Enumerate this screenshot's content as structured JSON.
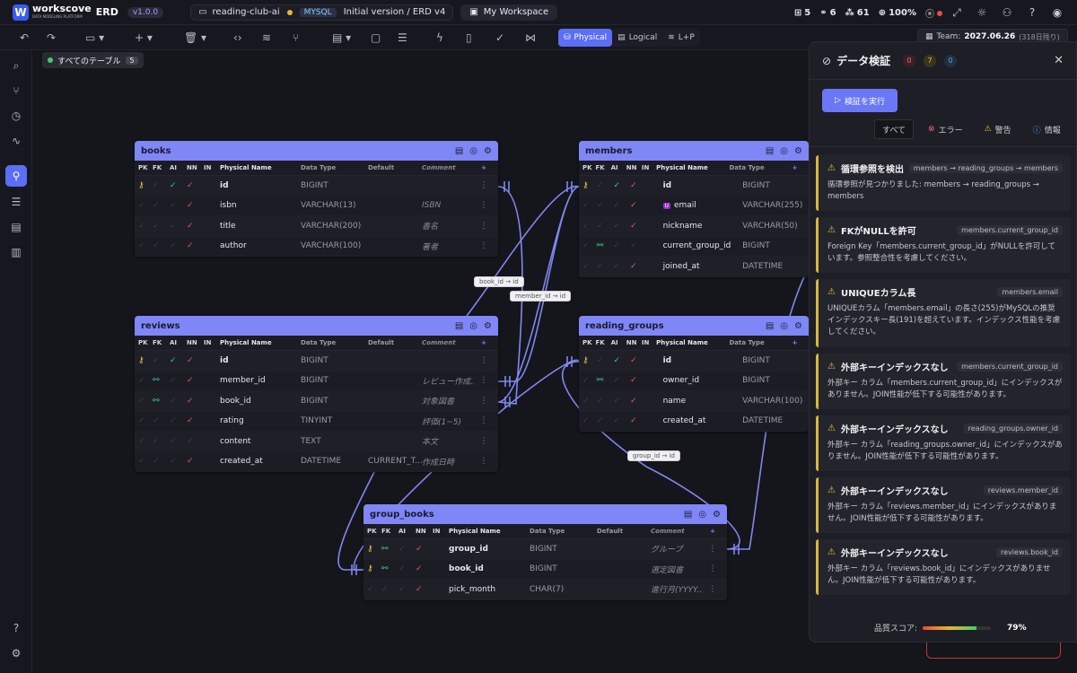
{
  "header": {
    "brand": "workscove",
    "brand_sub": "DATA MODELING PLATFORM",
    "app": "ERD",
    "version": "v1.0.0",
    "project": "reading-club-ai",
    "db": "MYSQL",
    "version_name": "Initial version / ERD v4",
    "workspace": "My Workspace",
    "stats": {
      "tables": "5",
      "relations": "6",
      "nodes": "61",
      "zoom": "100%"
    }
  },
  "toolbar": {
    "view_physical": "Physical",
    "view_logical": "Logical",
    "view_lp": "L+P",
    "team_label": "Team:",
    "team_date": "2027.06.26",
    "team_days": "(318日残り)"
  },
  "canvas": {
    "tab_label": "すべてのテーブル",
    "tab_count": "5"
  },
  "columns": [
    "PK",
    "FK",
    "AI",
    "NN",
    "IN",
    "Physical Name",
    "Data Type",
    "Default",
    "Comment"
  ],
  "tables": {
    "books": {
      "name": "books",
      "rows": [
        [
          "id",
          "BIGINT",
          "",
          ""
        ],
        [
          "isbn",
          "VARCHAR(13)",
          "",
          "ISBN"
        ],
        [
          "title",
          "VARCHAR(200)",
          "",
          "書名"
        ],
        [
          "author",
          "VARCHAR(100)",
          "",
          "著者"
        ]
      ]
    },
    "members": {
      "name": "members",
      "rows": [
        [
          "id",
          "BIGINT",
          "",
          ""
        ],
        [
          "email",
          "VARCHAR(255)",
          "",
          ""
        ],
        [
          "nickname",
          "VARCHAR(50)",
          "",
          ""
        ],
        [
          "current_group_id",
          "BIGINT",
          "",
          ""
        ],
        [
          "joined_at",
          "DATETIME",
          "",
          ""
        ]
      ]
    },
    "reviews": {
      "name": "reviews",
      "rows": [
        [
          "id",
          "BIGINT",
          "",
          ""
        ],
        [
          "member_id",
          "BIGINT",
          "",
          "レビュー作成..."
        ],
        [
          "book_id",
          "BIGINT",
          "",
          "対象図書"
        ],
        [
          "rating",
          "TINYINT",
          "",
          "評価(1~5)"
        ],
        [
          "content",
          "TEXT",
          "",
          "本文"
        ],
        [
          "created_at",
          "DATETIME",
          "CURRENT_T...",
          "作成日時"
        ]
      ]
    },
    "reading_groups": {
      "name": "reading_groups",
      "rows": [
        [
          "id",
          "BIGINT",
          "",
          ""
        ],
        [
          "owner_id",
          "BIGINT",
          "",
          ""
        ],
        [
          "name",
          "VARCHAR(100)",
          "",
          ""
        ],
        [
          "created_at",
          "DATETIME",
          "",
          ""
        ]
      ]
    },
    "group_books": {
      "name": "group_books",
      "rows": [
        [
          "group_id",
          "BIGINT",
          "",
          "グループ"
        ],
        [
          "book_id",
          "BIGINT",
          "",
          "選定図書"
        ],
        [
          "pick_month",
          "CHAR(7)",
          "",
          "進行月(YYYY..."
        ]
      ]
    }
  },
  "relations": [
    "book_id → id",
    "member_id → id",
    "group_id → id"
  ],
  "panel": {
    "title": "データ検証",
    "err": "0",
    "warn": "7",
    "info": "0",
    "run": "検証を実行",
    "f_all": "すべて",
    "f_err": "エラー",
    "f_warn": "警告",
    "f_info": "情報",
    "score_label": "品質スコア:",
    "score": "79%",
    "score_value": 0.79,
    "cards": [
      {
        "title": "循環参照を検出",
        "tag": "members → reading_groups → members",
        "body": "循環参照が見つかりました: members → reading_groups → members"
      },
      {
        "title": "FKがNULLを許可",
        "tag": "members.current_group_id",
        "body": "Foreign Key「members.current_group_id」がNULLを許可しています。参照整合性を考慮してください。"
      },
      {
        "title": "UNIQUEカラム長",
        "tag": "members.email",
        "body": "UNIQUEカラム「members.email」の長さ(255)がMySQLの推奨インデックスキー長(191)を超えています。インデックス性能を考慮してください。"
      },
      {
        "title": "外部キーインデックスなし",
        "tag": "members.current_group_id",
        "body": "外部キー カラム「members.current_group_id」にインデックスがありません。JOIN性能が低下する可能性があります。"
      },
      {
        "title": "外部キーインデックスなし",
        "tag": "reading_groups.owner_id",
        "body": "外部キー カラム「reading_groups.owner_id」にインデックスがありません。JOIN性能が低下する可能性があります。"
      },
      {
        "title": "外部キーインデックスなし",
        "tag": "reviews.member_id",
        "body": "外部キー カラム「reviews.member_id」にインデックスがありません。JOIN性能が低下する可能性があります。"
      },
      {
        "title": "外部キーインデックスなし",
        "tag": "reviews.book_id",
        "body": "外部キー カラム「reviews.book_id」にインデックスがありません。JOIN性能が低下する可能性があります。"
      }
    ]
  }
}
